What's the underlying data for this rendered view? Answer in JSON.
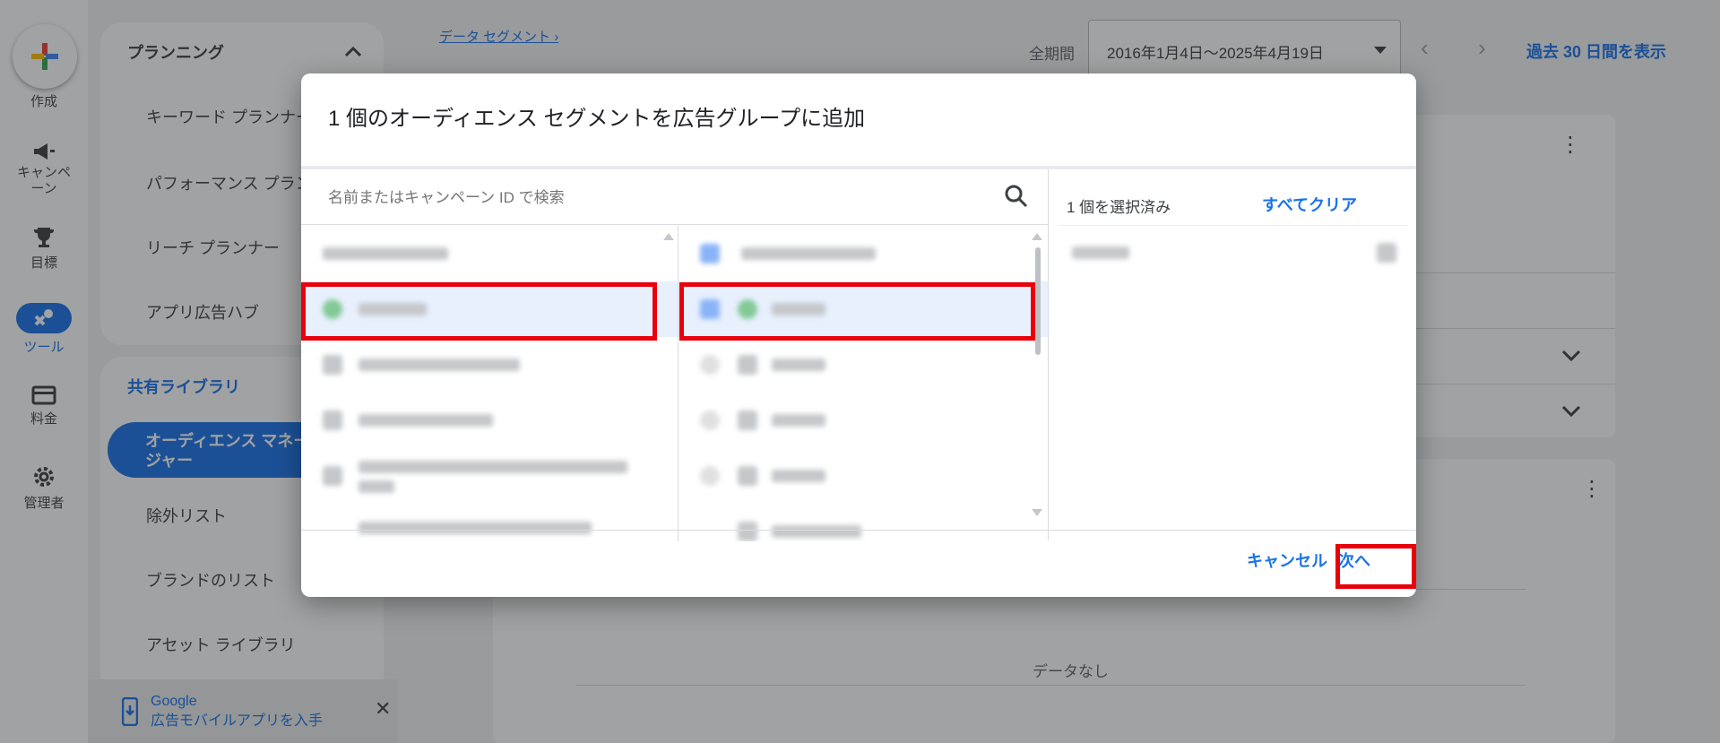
{
  "rail": {
    "create_label": "作成",
    "campaign_label": "キャンペーン",
    "goals_label": "目標",
    "tools_label": "ツール",
    "billing_label": "料金",
    "admin_label": "管理者"
  },
  "subnav": {
    "planning_heading": "プランニング",
    "planning_items": [
      "キーワード プランナー",
      "パフォーマンス プランナー",
      "リーチ プランナー",
      "アプリ広告ハブ"
    ],
    "shared_library_heading": "共有ライブラリ",
    "active_item": "オーディエンス マネージャー",
    "library_items": [
      "除外リスト",
      "ブランドのリスト",
      "アセット ライブラリ"
    ],
    "promo_line1": "Google",
    "promo_line2": "広告モバイルアプリを入手"
  },
  "main": {
    "breadcrumb": "データ セグメント ›",
    "period_label": "全期間",
    "date_range": "2016年1月4日～2025年4月19日",
    "show_30_days": "過去 30 日間を表示",
    "no_data": "データなし"
  },
  "dialog": {
    "title": "1 個のオーディエンス セグメントを広告グループに追加",
    "search_placeholder": "名前またはキャンペーン ID で検索",
    "selected_count": "1 個を選択済み",
    "clear_all": "すべてクリア",
    "cancel": "キャンセル",
    "next": "次へ"
  },
  "colors": {
    "accent": "#1a73e8",
    "highlight": "#e8000b",
    "selected_row": "#e8f0fe"
  }
}
